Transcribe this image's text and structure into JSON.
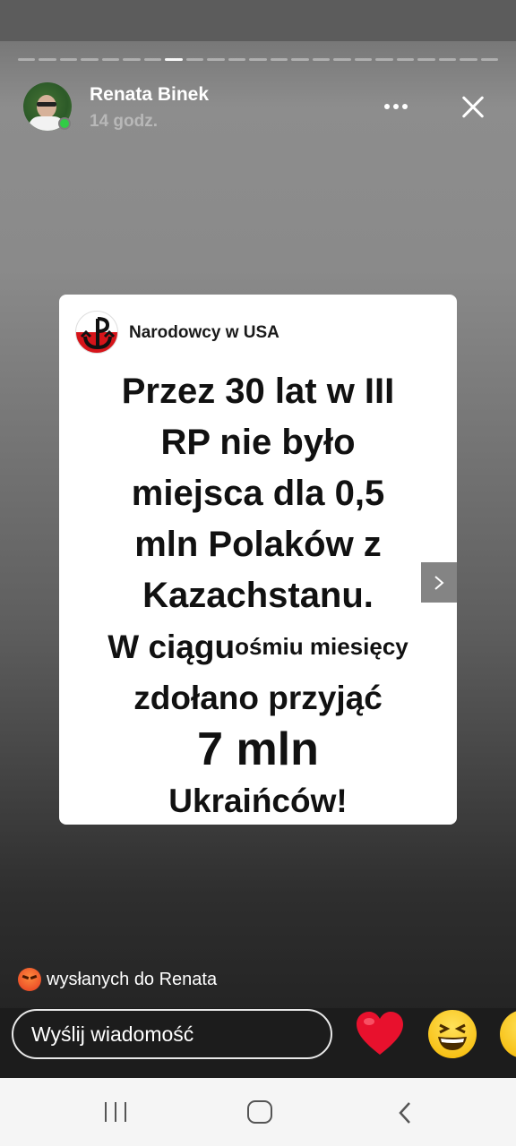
{
  "story": {
    "user_name": "Renata Binek",
    "time_ago": "14 godz.",
    "progress_segments": 23,
    "active_segment_index": 7
  },
  "post": {
    "page_name": "Narodowcy w USA",
    "lines": [
      "Przez 30 lat w III",
      "RP nie było",
      "miejsca dla 0,5",
      "mln Polaków z",
      "Kazachstanu."
    ],
    "line6_prefix": "W ciągu",
    "line6_suffix": "ośmiu miesięcy",
    "line7": "zdołano przyjąć",
    "line8": "7 mln",
    "line9": "Ukraińców!"
  },
  "reactions": {
    "sent_note": "wysłanych do Renata",
    "sent_icon": "angry-face-icon"
  },
  "composer": {
    "placeholder": "Wyślij wiadomość"
  },
  "colors": {
    "online": "#31cc46",
    "heart": "#e8112d",
    "logo_red": "#d6141a"
  }
}
